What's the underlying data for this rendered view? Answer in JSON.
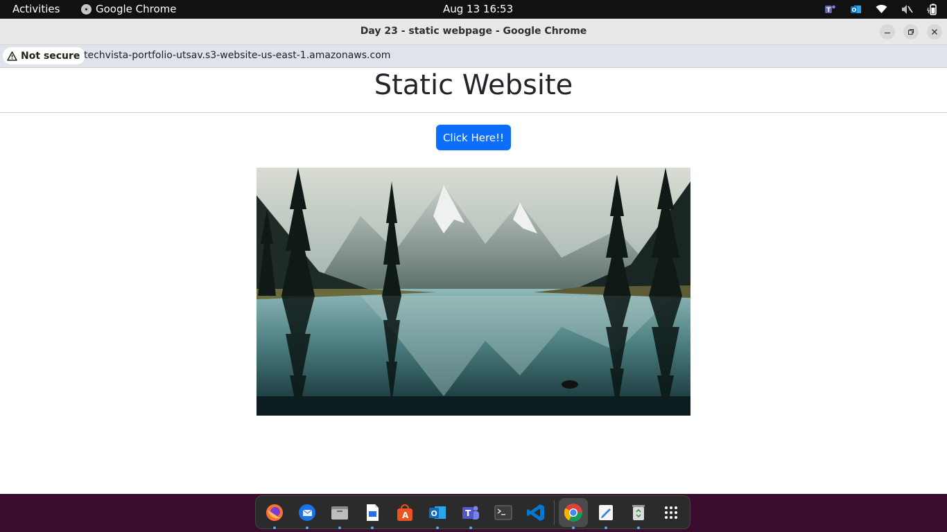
{
  "topbar": {
    "activities": "Activities",
    "app_name": "Google Chrome",
    "clock": "Aug 13  16:53",
    "tray_icons": [
      "teams-icon",
      "outlook-icon",
      "wifi-icon",
      "sound-muted-icon",
      "battery-icon"
    ]
  },
  "window": {
    "title": "Day 23 - static webpage - Google Chrome",
    "controls": [
      "minimize",
      "maximize",
      "close"
    ]
  },
  "addressbar": {
    "security_label": "Not secure",
    "url": "techvista-portfolio-utsav.s3-website-us-east-1.amazonaws.com"
  },
  "page": {
    "heading": "Static Website",
    "button_label": "Click Here!!",
    "image_subject": "mountain lake landscape with pine trees and reflection"
  },
  "dock": {
    "items": [
      {
        "name": "firefox",
        "running": true
      },
      {
        "name": "thunderbird",
        "running": true
      },
      {
        "name": "files",
        "running": true
      },
      {
        "name": "libreoffice-writer",
        "running": true
      },
      {
        "name": "app-center",
        "running": false
      },
      {
        "name": "outlook",
        "running": true
      },
      {
        "name": "teams",
        "running": true
      },
      {
        "name": "terminal",
        "running": false
      },
      {
        "name": "vscode",
        "running": false
      },
      {
        "name": "chrome",
        "running": true
      },
      {
        "name": "text-editor",
        "running": true
      },
      {
        "name": "trash",
        "running": true
      },
      {
        "name": "show-apps",
        "running": false
      }
    ]
  },
  "colors": {
    "button": "#0d6efd",
    "topbar": "#111111",
    "dock_background": "#3a0d2e"
  }
}
